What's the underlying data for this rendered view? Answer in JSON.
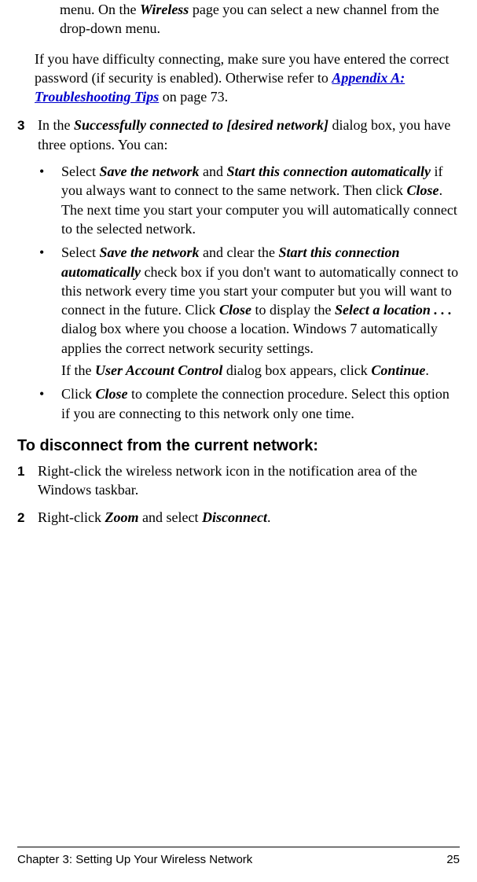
{
  "top_para_pre": "menu. On the ",
  "top_para_bold": "Wireless",
  "top_para_post": " page you can select a new channel from the drop-down menu.",
  "difficulty_pre": "If you have difficulty connecting, make sure you have entered the correct password (if security is enabled). Otherwise refer to ",
  "difficulty_link": "Appendix A: Troubleshooting Tips",
  "difficulty_post": " on page 73.",
  "step3_num": "3",
  "step3_pre": "In the ",
  "step3_bold": "Successfully connected to [desired network]",
  "step3_post": " dialog box, you have three options. You can:",
  "b1_t1": "Select ",
  "b1_b1": "Save the network",
  "b1_t2": " and ",
  "b1_b2": "Start this connection automatically",
  "b1_t3": " if you always want to connect to the same network. Then click ",
  "b1_b3": "Close",
  "b1_t4": ". The next time you start your computer you will automatically connect to the selected network.",
  "b2_t1": "Select ",
  "b2_b1": "Save the network",
  "b2_t2": " and clear the ",
  "b2_b2": "Start this connection automatically",
  "b2_t3": " check box if you don't want to automatically connect to this network every time you start your computer but you will want to connect in the future. Click ",
  "b2_b3": "Close",
  "b2_t4": " to display the ",
  "b2_b4": "Select a location . . .",
  "b2_t5": " dialog box where you choose a location. Windows 7 automatically applies the correct network security settings.",
  "b2_sub_t1": "If the ",
  "b2_sub_b1": "User Account Control",
  "b2_sub_t2": " dialog box appears, click ",
  "b2_sub_b2": "Continue",
  "b2_sub_t3": ".",
  "b3_t1": "Click ",
  "b3_b1": "Close",
  "b3_t2": " to complete the connection procedure. Select this option if you are connecting to this network only one time.",
  "heading": "To disconnect from the current network:",
  "d1_num": "1",
  "d1_text": "Right-click the wireless network icon in the notification area of the Windows taskbar.",
  "d2_num": "2",
  "d2_t1": "Right-click ",
  "d2_b1": "Zoom",
  "d2_t2": " and select ",
  "d2_b2": "Disconnect",
  "d2_t3": ".",
  "footer_left": "Chapter 3: Setting Up Your Wireless Network",
  "footer_right": "25"
}
